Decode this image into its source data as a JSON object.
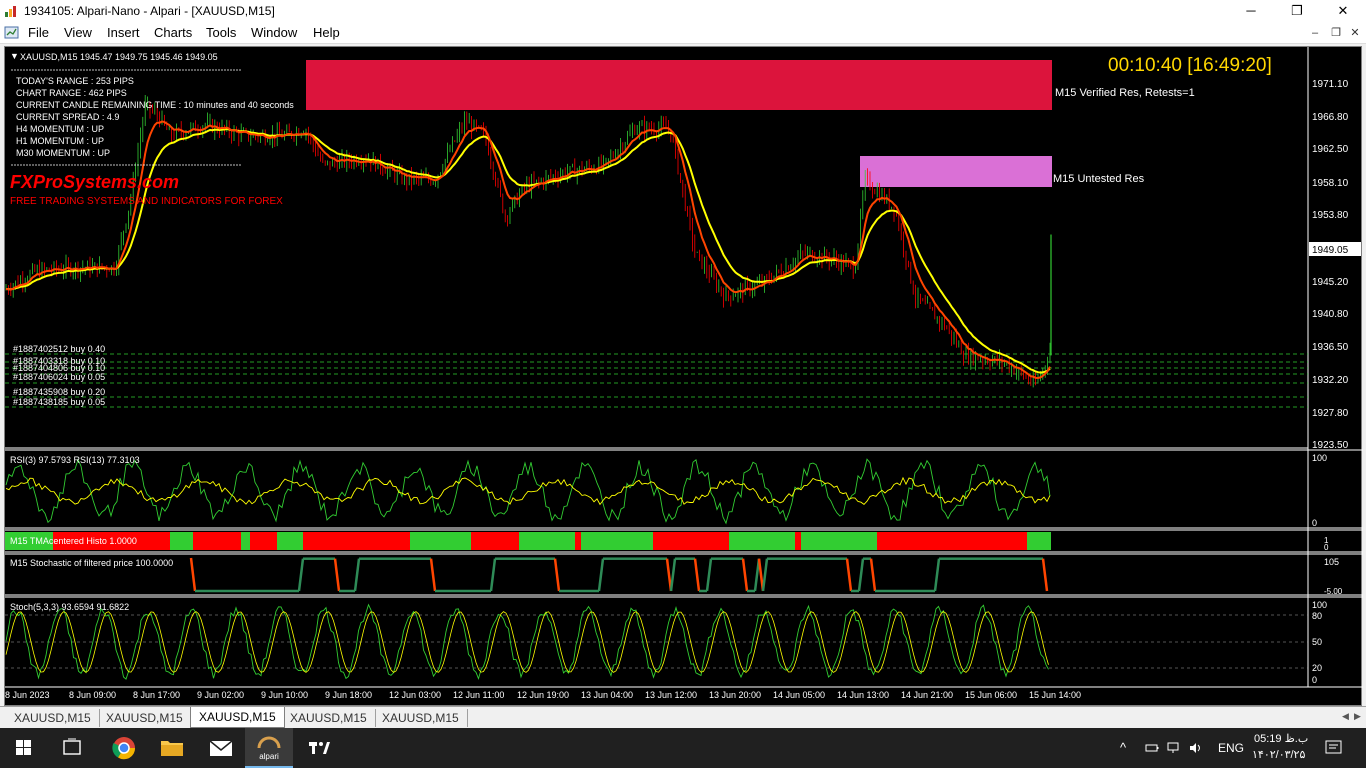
{
  "window": {
    "title": "1934105: Alpari-Nano - Alpari - [XAUUSD,M15]",
    "controls": [
      "─",
      "❐",
      "✕"
    ]
  },
  "menu": {
    "items": [
      "File",
      "View",
      "Insert",
      "Charts",
      "Tools",
      "Window",
      "Help"
    ],
    "mdi_controls": [
      "–",
      "❐",
      "✕"
    ]
  },
  "chart": {
    "header": "XAUUSD,M15  1945.47 1949.75 1945.46 1949.05",
    "timer": "00:10:40 [16:49:20]",
    "info_lines": [
      "TODAY'S RANGE : 253 PIPS",
      "CHART RANGE : 462 PIPS",
      "CURRENT CANDLE REMAINING TIME : 10 minutes and 40 seconds",
      "CURRENT SPREAD : 4.9",
      "H4 MOMENTUM : UP",
      "H1 MOMENTUM : UP",
      "M30 MOMENTUM : UP"
    ],
    "brand": "FXProSystems.com",
    "brand_sub": "FREE TRADING SYSTEMS AND INDICATORS FOR FOREX",
    "zone_verified_label": "M15 Verified Res, Retests=1",
    "zone_untested_label": "M15 Untested Res",
    "orders": [
      "#1887402512 buy 0.40",
      "#1887403318 buy 0.10",
      "#1887404806 buy 0.10",
      "#1887406024 buy 0.05",
      "#1887435908 buy 0.20",
      "#1887438185 buy 0.05"
    ],
    "price_ticks": [
      "1971.10",
      "1966.80",
      "1962.50",
      "1958.10",
      "1953.80",
      "1949.05",
      "1945.20",
      "1940.80",
      "1936.50",
      "1932.20",
      "1927.80",
      "1923.50"
    ],
    "current_price": "1949.05",
    "time_ticks": [
      "8 Jun 2023",
      "8 Jun 09:00",
      "8 Jun 17:00",
      "9 Jun 02:00",
      "9 Jun 10:00",
      "9 Jun 18:00",
      "12 Jun 03:00",
      "12 Jun 11:00",
      "12 Jun 19:00",
      "13 Jun 04:00",
      "13 Jun 12:00",
      "13 Jun 20:00",
      "14 Jun 05:00",
      "14 Jun 13:00",
      "14 Jun 21:00",
      "15 Jun 06:00",
      "15 Jun 14:00"
    ],
    "rsi_label": "RSI(3) 97.5793  RSI(13) 77.3103",
    "rsi_ticks": [
      "100",
      "0"
    ],
    "histo_label": "M15  TMAcentered Histo 1.0000",
    "histo_ticks": [
      "1",
      "0"
    ],
    "stoch_filtered_label": "M15 Stochastic of filtered price 100.0000",
    "stoch_filtered_ticks": [
      "105",
      "-5.00"
    ],
    "stoch_label": "Stoch(5,3,3) 93.6594 91.6822",
    "stoch_ticks": [
      "100",
      "80",
      "50",
      "20",
      "0"
    ],
    "colors": {
      "bull": "#32cd32",
      "bear": "#ff0000",
      "ma_fast": "#ff4500",
      "ma_slow": "#ffff00",
      "zone_verified": "#dc143c",
      "zone_untested": "#da70d6",
      "timer": "#ffd700",
      "brand": "#ff0000"
    },
    "histo_segments": [
      "bull",
      "bear",
      "bull",
      "bear",
      "bull",
      "bear",
      "bull",
      "bear",
      "bull",
      "bear",
      "bull",
      "bear",
      "bull",
      "bear",
      "bull",
      "bear",
      "bull",
      "bear",
      "bull"
    ]
  },
  "tabs": [
    "XAUUSD,M15",
    "XAUUSD,M15",
    "XAUUSD,M15",
    "XAUUSD,M15",
    "XAUUSD,M15"
  ],
  "active_tab": 2,
  "taskbar": {
    "icons": [
      "windows-start-icon",
      "task-view-icon",
      "chrome-icon",
      "file-explorer-icon",
      "mail-icon",
      "alpari-icon",
      "tradingview-icon"
    ],
    "alpari_label": "alpari",
    "lang": "ENG",
    "time": "05:19 ب.ظ",
    "date": "۱۴۰۲/۰۳/۲۵"
  }
}
